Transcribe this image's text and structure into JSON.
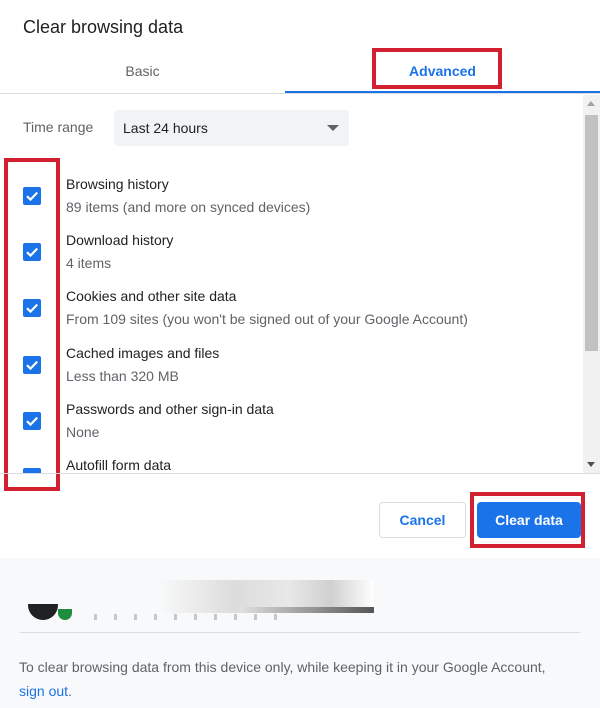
{
  "dialog": {
    "title": "Clear browsing data"
  },
  "tabs": [
    {
      "label": "Basic",
      "selected": false
    },
    {
      "label": "Advanced",
      "selected": true
    }
  ],
  "time_range": {
    "label": "Time range",
    "value": "Last 24 hours"
  },
  "items": [
    {
      "title": "Browsing history",
      "subtitle": "89 items (and more on synced devices)",
      "checked": true
    },
    {
      "title": "Download history",
      "subtitle": "4 items",
      "checked": true
    },
    {
      "title": "Cookies and other site data",
      "subtitle": "From 109 sites (you won't be signed out of your Google Account)",
      "checked": true
    },
    {
      "title": "Cached images and files",
      "subtitle": "Less than 320 MB",
      "checked": true
    },
    {
      "title": "Passwords and other sign-in data",
      "subtitle": "None",
      "checked": true
    },
    {
      "title": "Autofill form data",
      "subtitle": "",
      "checked": true
    }
  ],
  "buttons": {
    "cancel": "Cancel",
    "clear": "Clear data"
  },
  "footer": {
    "text": "To clear browsing data from this device only, while keeping it in your Google Account, ",
    "link": "sign out",
    "suffix": "."
  },
  "colors": {
    "accent": "#1a73e8",
    "highlight": "#d32030"
  },
  "icons": {
    "dropdown": "caret-down-icon",
    "checkbox": "check-icon"
  }
}
